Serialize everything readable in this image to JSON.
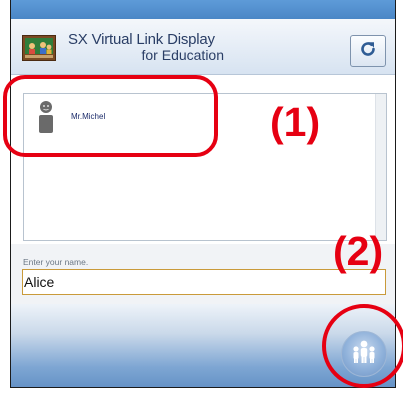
{
  "app": {
    "title": "SX Virtual Link Display",
    "subtitle": "for Education",
    "logo_icon": "classroom-logo-icon",
    "refresh_icon": "refresh-icon"
  },
  "teachers": [
    {
      "name": "Mr.Michel",
      "icon": "person-avatar-icon"
    }
  ],
  "name_field": {
    "label": "Enter your name.",
    "value": "Alice"
  },
  "join_button": {
    "icon": "people-group-icon"
  },
  "callouts": {
    "one": "(1)",
    "two": "(2)"
  },
  "colors": {
    "accent_blue": "#4a86c6",
    "callout_red": "#e60012",
    "title_text": "#2a3e66"
  }
}
